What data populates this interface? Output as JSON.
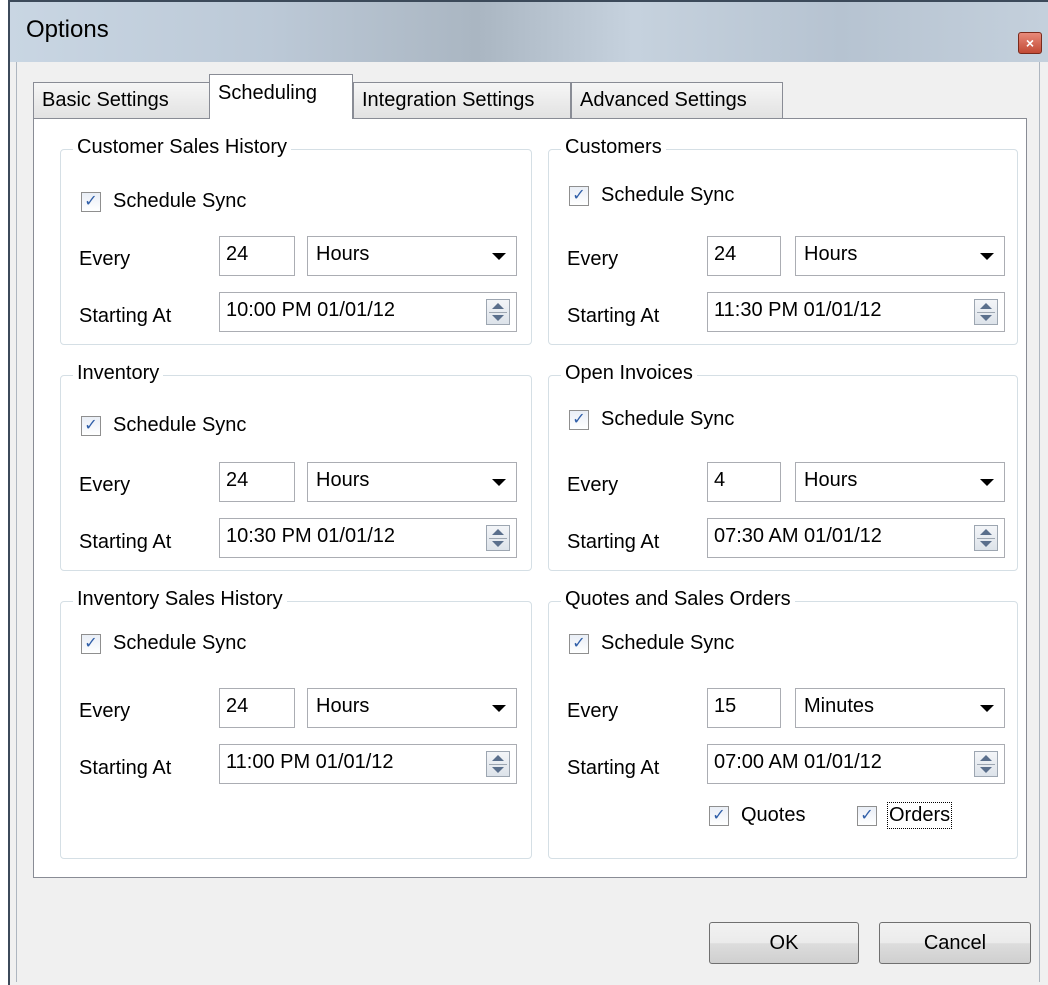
{
  "window": {
    "title": "Options",
    "close_glyph": "×"
  },
  "tabs": [
    {
      "label": "Basic Settings",
      "active": false
    },
    {
      "label": "Scheduling",
      "active": true
    },
    {
      "label": "Integration Settings",
      "active": false
    },
    {
      "label": "Advanced Settings",
      "active": false
    }
  ],
  "labels": {
    "schedule_sync": "Schedule Sync",
    "every": "Every",
    "starting_at": "Starting At"
  },
  "groups": [
    {
      "title": "Customer Sales History",
      "schedule_sync": true,
      "every": "24",
      "unit": "Hours",
      "start": "10:00 PM 01/01/12"
    },
    {
      "title": "Customers",
      "schedule_sync": true,
      "every": "24",
      "unit": "Hours",
      "start": "11:30 PM 01/01/12"
    },
    {
      "title": "Inventory",
      "schedule_sync": true,
      "every": "24",
      "unit": "Hours",
      "start": "10:30 PM 01/01/12"
    },
    {
      "title": "Open Invoices",
      "schedule_sync": true,
      "every": "4",
      "unit": "Hours",
      "start": "07:30 AM 01/01/12"
    },
    {
      "title": "Inventory Sales History",
      "schedule_sync": true,
      "every": "24",
      "unit": "Hours",
      "start": "11:00 PM 01/01/12"
    },
    {
      "title": "Quotes and Sales Orders",
      "schedule_sync": true,
      "every": "15",
      "unit": "Minutes",
      "start": "07:00 AM 01/01/12",
      "extra": {
        "quotes_label": "Quotes",
        "quotes_checked": true,
        "orders_label": "Orders",
        "orders_checked": true
      }
    }
  ],
  "buttons": {
    "ok": "OK",
    "cancel": "Cancel"
  }
}
